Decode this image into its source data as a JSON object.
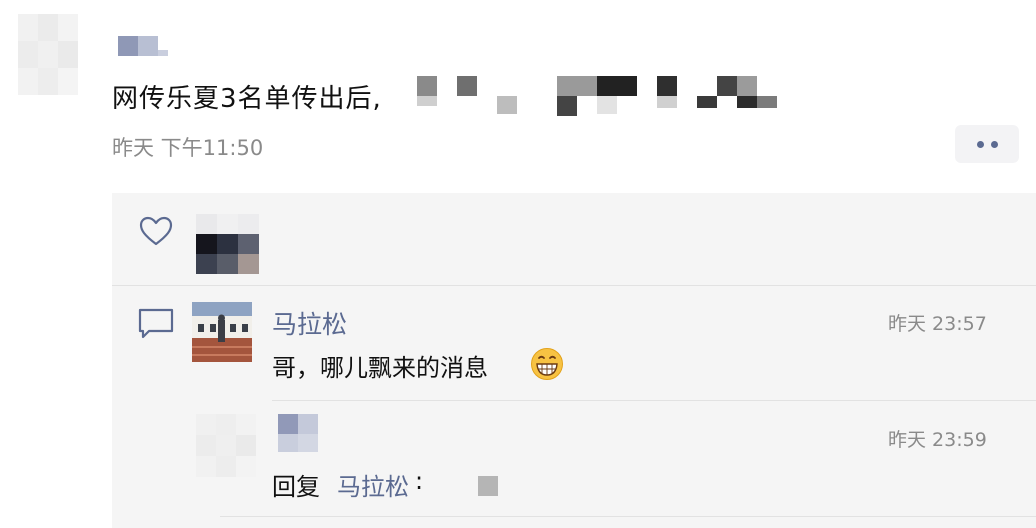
{
  "post": {
    "text": "网传乐夏3名单传出后,",
    "time": "昨天 下午11:50"
  },
  "icons": {
    "like": "heart-outline-icon",
    "comment": "speech-bubble-icon",
    "more": "more-dots-icon",
    "emoji": "grinning-face-emoji"
  },
  "comment": {
    "author": "马拉松",
    "time": "昨天 23:57",
    "text": "哥，哪儿飘来的消息",
    "emoji": "😁"
  },
  "reply": {
    "time": "昨天 23:59",
    "prefix": "回复",
    "target": "马拉松",
    "colon": ":"
  },
  "colors": {
    "link": "#5b6a91",
    "time": "#8a8a8a",
    "panel": "#f5f5f5"
  }
}
